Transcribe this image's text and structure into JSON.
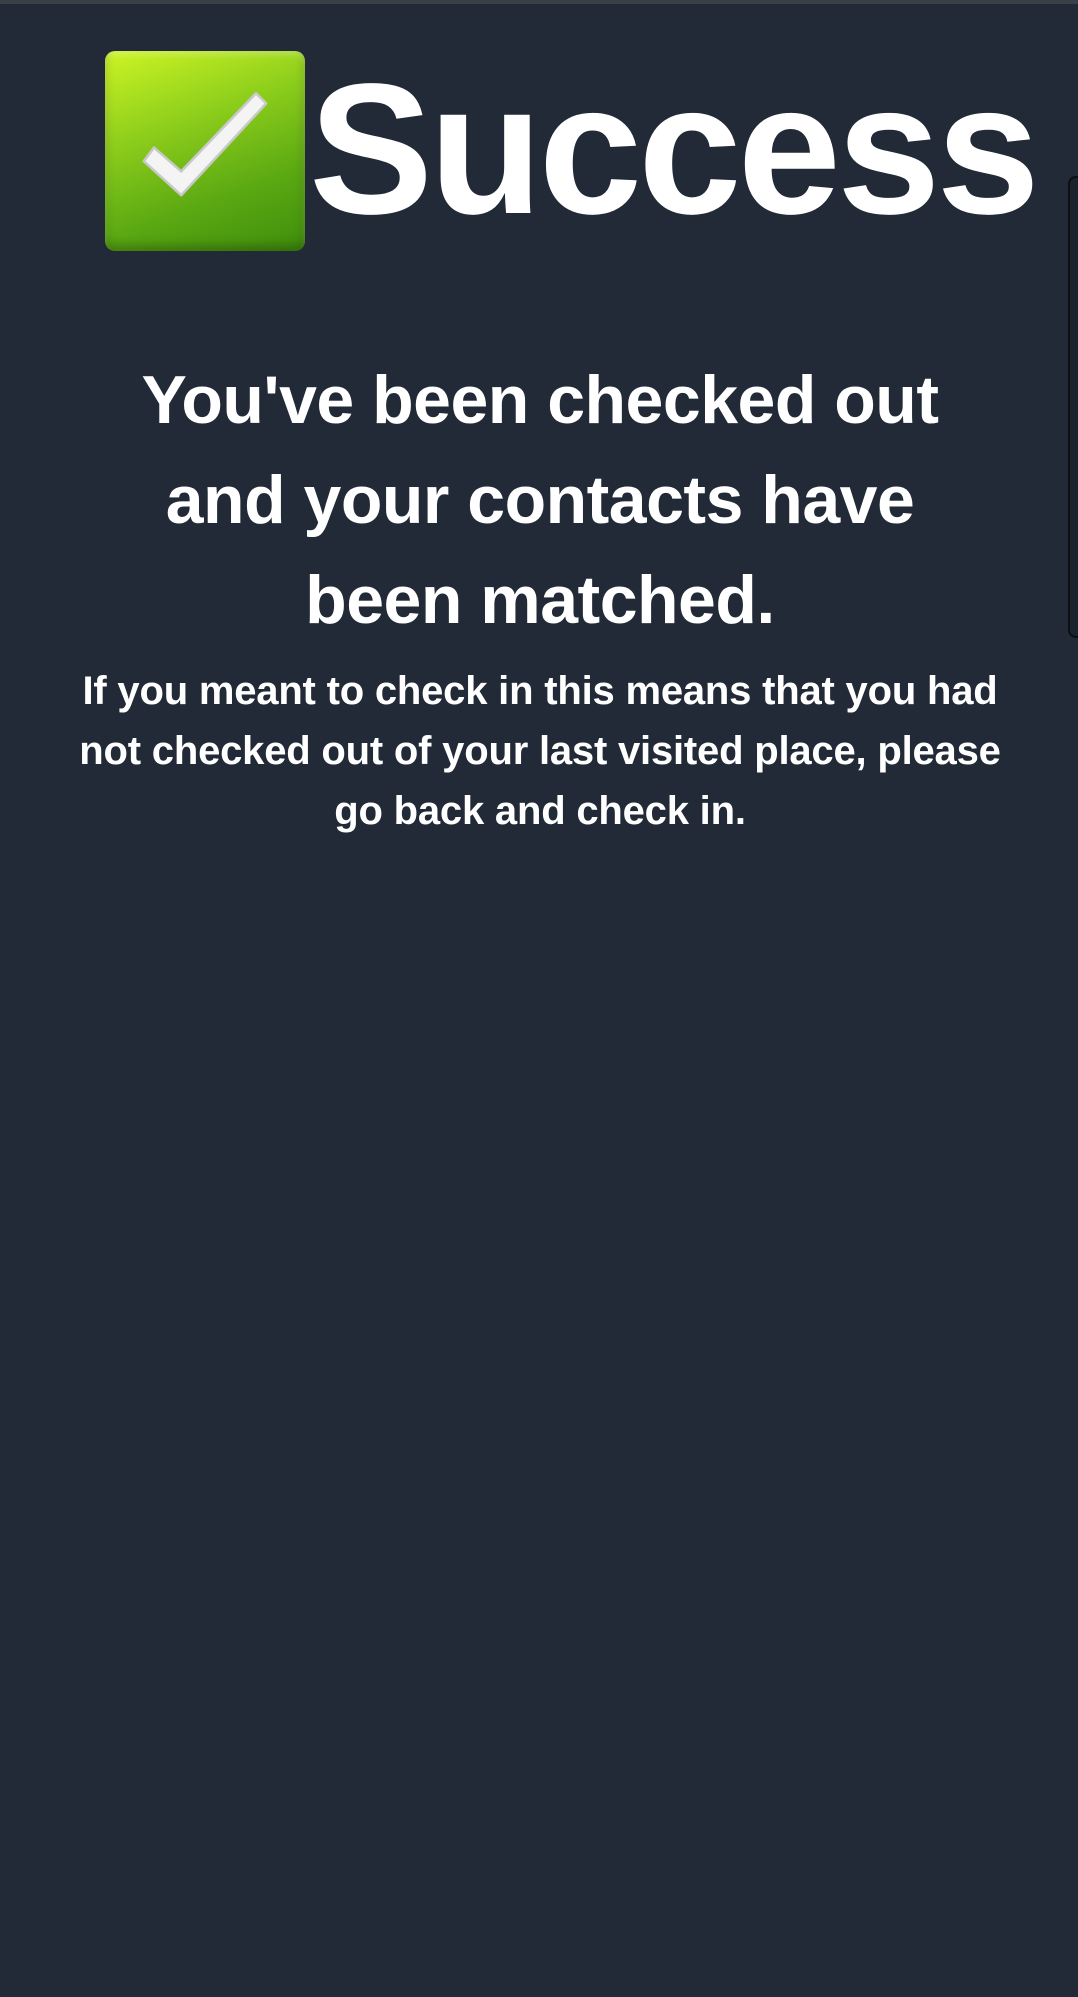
{
  "status": {
    "icon": "check-mark-button-icon",
    "title": "Success"
  },
  "message": {
    "headline": "You've been checked out and your contacts have been matched.",
    "detail": "If you meant to check in this means that you had not checked out of your last visited place, please go back and check in."
  },
  "colors": {
    "background": "#212a36",
    "text": "#ffffff",
    "check_green": "#5aa812"
  }
}
